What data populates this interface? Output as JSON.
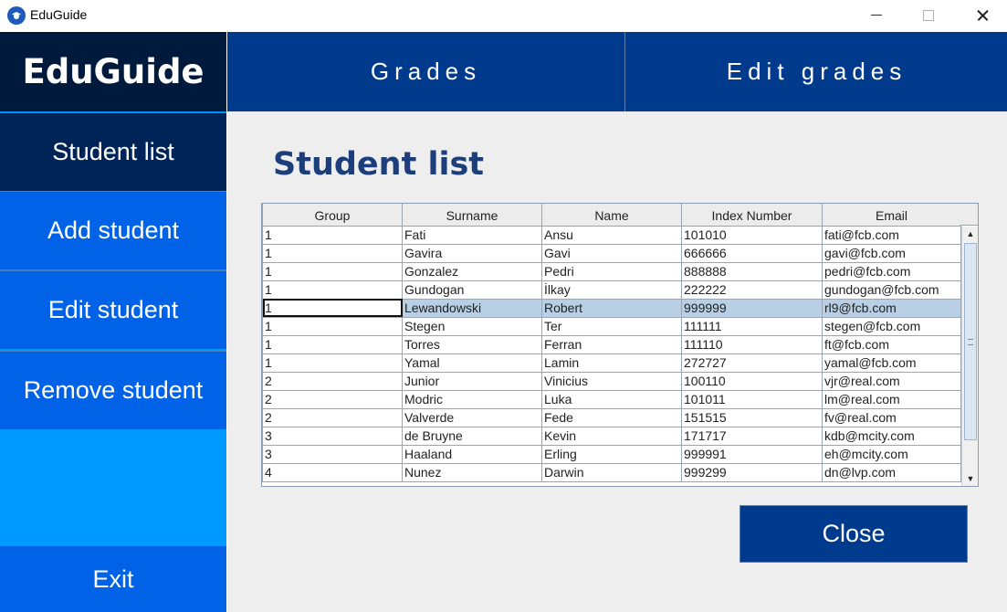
{
  "window": {
    "title": "EduGuide",
    "app_icon": "graduation-cap-icon"
  },
  "sidebar": {
    "logo": "EduGuide",
    "items": [
      {
        "label": "Student list"
      },
      {
        "label": "Add student"
      },
      {
        "label": "Edit student"
      },
      {
        "label": "Remove student"
      }
    ],
    "exit_label": "Exit"
  },
  "topnav": {
    "tabs": [
      {
        "label": "Grades"
      },
      {
        "label": "Edit grades"
      }
    ]
  },
  "main": {
    "title": "Student list",
    "table": {
      "columns": [
        "Group",
        "Surname",
        "Name",
        "Index Number",
        "Email"
      ],
      "rows": [
        [
          "1",
          "Fati",
          "Ansu",
          "101010",
          "fati@fcb.com"
        ],
        [
          "1",
          "Gavira",
          "Gavi",
          "666666",
          "gavi@fcb.com"
        ],
        [
          "1",
          "Gonzalez",
          "Pedri",
          "888888",
          "pedri@fcb.com"
        ],
        [
          "1",
          "Gundogan",
          "İlkay",
          "222222",
          "gundogan@fcb.com"
        ],
        [
          "1",
          "Lewandowski",
          "Robert",
          "999999",
          "rl9@fcb.com"
        ],
        [
          "1",
          "Stegen",
          "Ter",
          "111111",
          "stegen@fcb.com"
        ],
        [
          "1",
          "Torres",
          "Ferran",
          "111110",
          "ft@fcb.com"
        ],
        [
          "1",
          "Yamal",
          "Lamin",
          "272727",
          "yamal@fcb.com"
        ],
        [
          "2",
          "Junior",
          "Vinicius",
          "100110",
          "vjr@real.com"
        ],
        [
          "2",
          "Modric",
          "Luka",
          "101011",
          "lm@real.com"
        ],
        [
          "2",
          "Valverde",
          "Fede",
          "151515",
          "fv@real.com"
        ],
        [
          "3",
          "de Bruyne",
          "Kevin",
          "171717",
          "kdb@mcity.com"
        ],
        [
          "3",
          "Haaland",
          "Erling",
          "999991",
          "eh@mcity.com"
        ],
        [
          "4",
          "Nunez",
          "Darwin",
          "999299",
          "dn@lvp.com"
        ]
      ],
      "selected_row": 4
    },
    "close_label": "Close"
  },
  "colors": {
    "sidebar_dark": "#001a3d",
    "sidebar_active": "#002457",
    "sidebar_button": "#0062e6",
    "sidebar_bg": "#0099ff",
    "topnav": "#003a8c",
    "title_text": "#1c3f7c",
    "selected_row": "#b8cfe5"
  }
}
